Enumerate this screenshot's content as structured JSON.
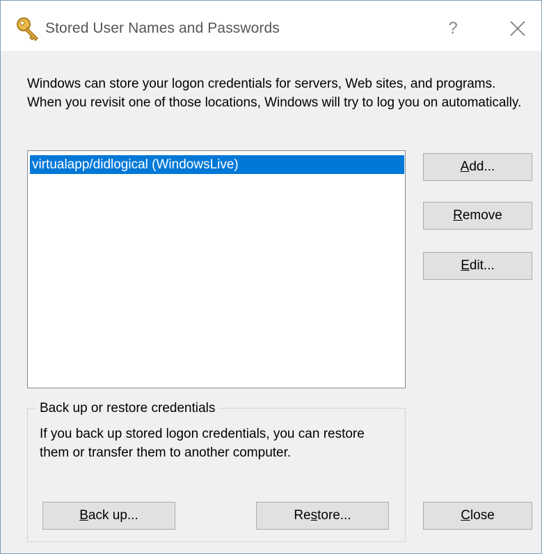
{
  "window": {
    "title": "Stored User Names and Passwords",
    "help_label": "?"
  },
  "description": "Windows can store your logon credentials for servers, Web sites, and programs. When you revisit one of those locations, Windows will try to log you on automatically.",
  "credentials": {
    "items": [
      {
        "label": "virtualapp/didlogical (WindowsLive)",
        "selected": true
      }
    ]
  },
  "buttons": {
    "add": {
      "mnemonic": "A",
      "rest": "dd..."
    },
    "remove": {
      "mnemonic": "R",
      "rest": "emove"
    },
    "edit": {
      "mnemonic": "E",
      "rest": "dit..."
    },
    "backup": {
      "mnemonic": "B",
      "rest": "ack up..."
    },
    "restore": {
      "pre": "Re",
      "mnemonic": "s",
      "rest": "tore..."
    },
    "close": {
      "mnemonic": "C",
      "rest": "lose"
    }
  },
  "backup_group": {
    "legend": "Back up or restore credentials",
    "text": "If you back up stored logon credentials, you can restore them or transfer them to another computer."
  },
  "colors": {
    "selection": "#0078d7",
    "title_text": "#555555",
    "button_face": "#e1e1e1"
  },
  "icons": {
    "title": "key-icon",
    "close": "close-icon"
  }
}
